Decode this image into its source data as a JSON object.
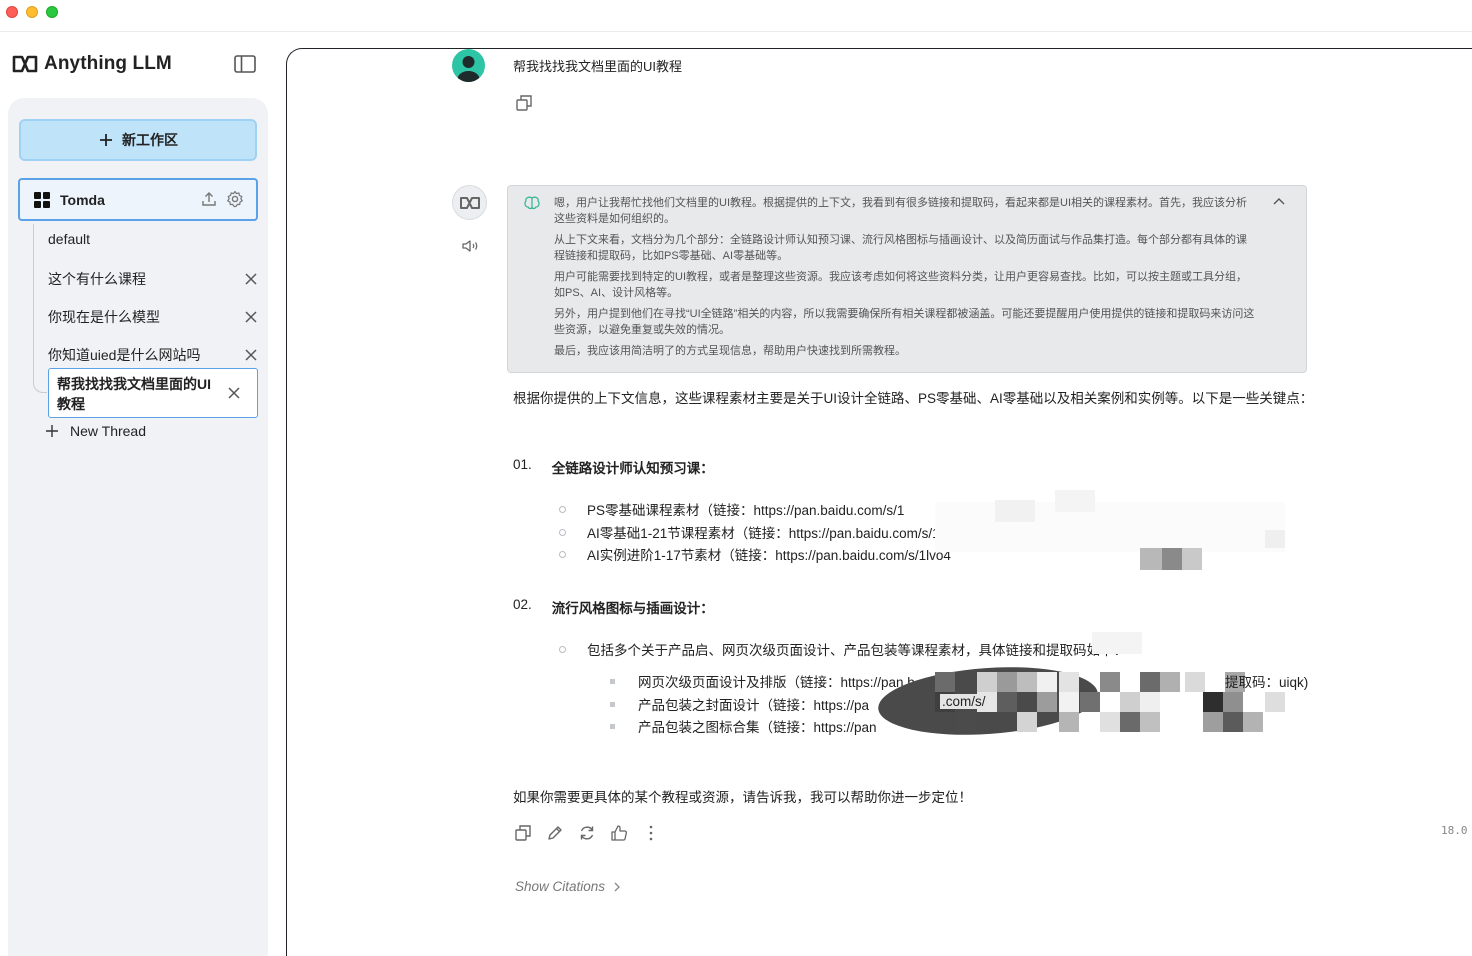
{
  "brand": {
    "name": "Anything LLM"
  },
  "sidebar": {
    "new_workspace_label": "新工作区",
    "workspace": {
      "name": "Tomda"
    },
    "threads": [
      {
        "label": "default"
      },
      {
        "label": "这个有什么课程"
      },
      {
        "label": "你现在是什么模型"
      },
      {
        "label": "你知道uied是什么网站吗"
      }
    ],
    "active_thread": {
      "label": "帮我找找我文档里面的UI教程"
    },
    "new_thread_label": "New Thread"
  },
  "chat": {
    "user_message": "帮我找找我文档里面的UI教程",
    "thinking": [
      "嗯，用户让我帮忙找他们文档里的UI教程。根据提供的上下文，我看到有很多链接和提取码，看起来都是UI相关的课程素材。首先，我应该分析这些资料是如何组织的。",
      "从上下文来看，文档分为几个部分：全链路设计师认知预习课、流行风格图标与插画设计、以及简历面试与作品集打造。每个部分都有具体的课程链接和提取码，比如PS零基础、AI零基础等。",
      "用户可能需要找到特定的UI教程，或者是整理这些资源。我应该考虑如何将这些资料分类，让用户更容易查找。比如，可以按主题或工具分组，如PS、AI、设计风格等。",
      "另外，用户提到他们在寻找“UI全链路”相关的内容，所以我需要确保所有相关课程都被涵盖。可能还要提醒用户使用提供的链接和提取码来访问这些资源，以避免重复或失效的情况。",
      "最后，我应该用简洁明了的方式呈现信息，帮助用户快速找到所需教程。"
    ],
    "answer_intro": "根据你提供的上下文信息，这些课程素材主要是关于UI设计全链路、PS零基础、AI零基础以及相关案例和实例等。以下是一些关键点：",
    "sections": [
      {
        "number": "01.",
        "title": "全链路设计师认知预习课：",
        "items": [
          "PS零基础课程素材（链接：https://pan.baidu.com/s/1",
          "AI零基础1-21节课程素材（链接：https://pan.baidu.com/s/1C",
          "AI实例进阶1-17节素材（链接：https://pan.baidu.com/s/1lvo4"
        ]
      },
      {
        "number": "02.",
        "title": "流行风格图标与插画设计：",
        "items": [
          "包括多个关于产品启、网页次级页面设计、产品包装等课程素材，具体链接和提取码如下："
        ],
        "subitems": [
          "网页次级页面设计及排版（链接：https://pan.b",
          "产品包装之封面设计（链接：https://pa",
          "产品包装之图标合集（链接：https://pan"
        ],
        "subitem_tail": "提取码：uiqk)",
        "subitem_mid": ".com/s/"
      }
    ],
    "closing": "如果你需要更具体的某个教程或资源，请告诉我，我可以帮助你进一步定位！",
    "token_stat": "18.0",
    "show_citations": "Show Citations"
  }
}
